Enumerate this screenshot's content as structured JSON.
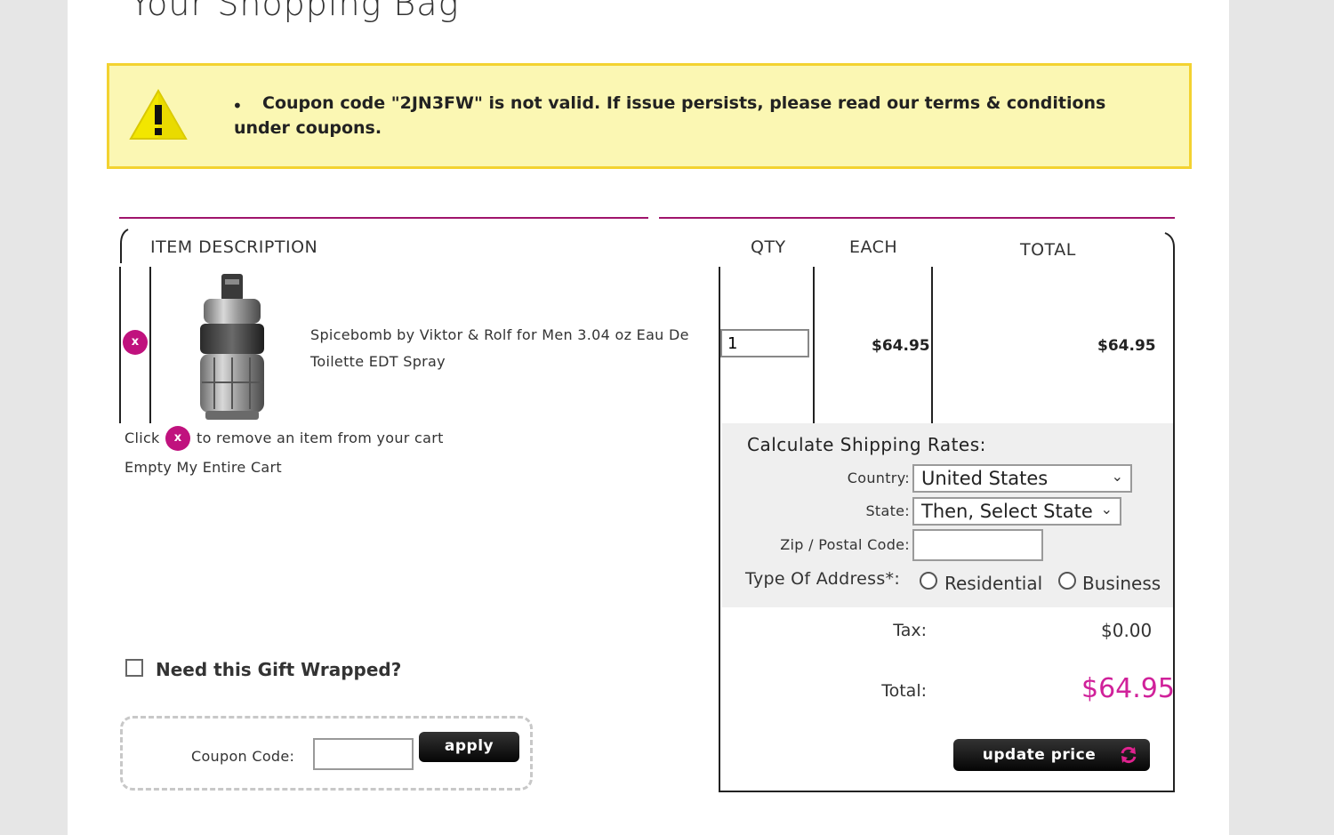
{
  "page": {
    "title": "Your Shopping Bag"
  },
  "alert": {
    "message": "Coupon code \"2JN3FW\" is not valid. If issue persists, please read our terms & conditions under coupons."
  },
  "cart": {
    "headers": {
      "item": "ITEM  DESCRIPTION",
      "qty": "QTY",
      "each": "EACH",
      "total": "TOTAL"
    },
    "items": [
      {
        "name": "Spicebomb by Viktor & Rolf for Men 3.04 oz Eau De Toilette EDT Spray",
        "qty": "1",
        "each": "$64.95",
        "total": "$64.95",
        "remove_glyph": "x"
      }
    ],
    "remove_hint_before": "Click",
    "remove_hint_after": "to remove an item from your cart",
    "empty_cart_label": "Empty My Entire Cart"
  },
  "shipping": {
    "heading": "Calculate Shipping Rates:",
    "country_label": "Country:",
    "country_value": "United States",
    "state_label": "State:",
    "state_value": "Then, Select State",
    "zip_label": "Zip / Postal Code:",
    "zip_value": "",
    "address_type_label": "Type Of Address*:",
    "residential_label": "Residential",
    "business_label": "Business"
  },
  "summary": {
    "tax_label": "Tax:",
    "tax_value": "$0.00",
    "total_label": "Total:",
    "total_value": "$64.95",
    "update_button": "update price"
  },
  "gift": {
    "label": "Need this Gift Wrapped?",
    "checked": false
  },
  "coupon": {
    "label": "Coupon Code:",
    "value": "",
    "apply_button": "apply"
  },
  "colors": {
    "accent": "#d0219a",
    "alert_bg": "#fbf7b3",
    "alert_border": "#f3d230",
    "remove": "#c0127e"
  },
  "icons": {
    "warning": "warning-icon",
    "remove": "remove-x-icon",
    "refresh": "refresh-icon",
    "chevron": "chevron-down-icon"
  }
}
